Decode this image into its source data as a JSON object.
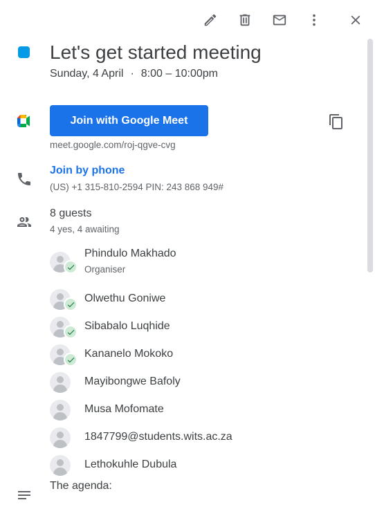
{
  "toolbar": {
    "icons": [
      "edit-icon",
      "delete-icon",
      "email-icon",
      "more-vert-icon",
      "close-icon"
    ]
  },
  "event": {
    "color": "#039be5",
    "title": "Let's get started meeting",
    "date": "Sunday, 4 April",
    "separator": "·",
    "time": "8:00 – 10:00pm"
  },
  "meet": {
    "button_label": "Join with Google Meet",
    "url": "meet.google.com/roj-qgve-cvg",
    "accent": "#1a73e8"
  },
  "phone": {
    "link_label": "Join by phone",
    "details": "(US) +1 315-810-2594 PIN: 243 868 949#"
  },
  "guests": {
    "title": "8 guests",
    "summary": "4 yes, 4 awaiting",
    "list": [
      {
        "name": "Phindulo Makhado",
        "role": "Organiser",
        "accepted": true
      },
      {
        "name": "Olwethu Goniwe",
        "accepted": true
      },
      {
        "name": "Sibabalo Luqhide",
        "accepted": true
      },
      {
        "name": "Kananelo Mokoko",
        "accepted": true
      },
      {
        "name": "Mayibongwe Bafoly",
        "accepted": false
      },
      {
        "name": "Musa Mofomate",
        "accepted": false
      },
      {
        "name": "1847799@students.wits.ac.za",
        "accepted": false
      },
      {
        "name": "Lethokuhle Dubula",
        "accepted": false
      }
    ]
  },
  "description": {
    "text": "The agenda:"
  }
}
